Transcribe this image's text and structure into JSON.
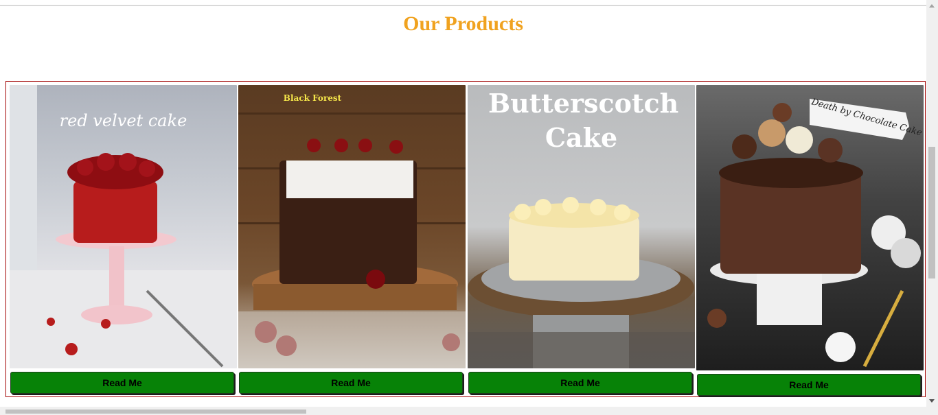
{
  "section": {
    "title": "Our Products"
  },
  "products": [
    {
      "name": "Red Velvet Cake",
      "image_caption": "red velvet cake",
      "button_label": "Read Me"
    },
    {
      "name": "Black Forest",
      "image_caption": "Black Forest",
      "button_label": "Read Me"
    },
    {
      "name": "Butterscotch Cake",
      "image_caption": "Butterscotch Cake",
      "button_label": "Read Me"
    },
    {
      "name": "Death by Chocolate Cake",
      "image_caption": "Death by Chocolate Cake",
      "button_label": "Read Me"
    }
  ],
  "colors": {
    "title": "#f0a21f",
    "button": "#078207",
    "border": "#a10000"
  }
}
